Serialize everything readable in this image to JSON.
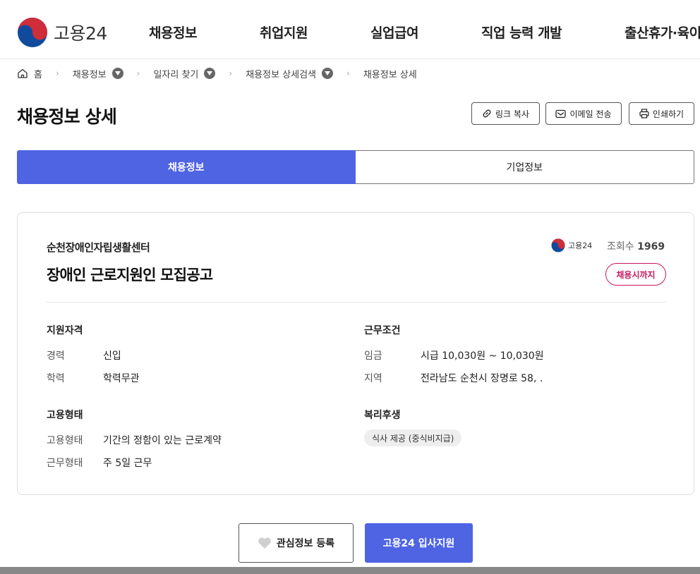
{
  "header": {
    "logo_text": "고용24",
    "nav": [
      "채용정보",
      "취업지원",
      "실업급여",
      "직업 능력 개발",
      "출산휴가·육이"
    ]
  },
  "breadcrumb": {
    "home": "홈",
    "items": [
      "채용정보",
      "일자리 찾기",
      "채용정보 상세검색",
      "채용정보 상세"
    ]
  },
  "page": {
    "title": "채용정보 상세",
    "actions": {
      "copy_link": "링크 복사",
      "email": "이메일 전송",
      "print": "인쇄하기"
    }
  },
  "tabs": [
    "채용정보",
    "기업정보"
  ],
  "posting": {
    "company": "순천장애인자립생활센터",
    "title": "장애인 근로지원인 모집공고",
    "source": "고용24",
    "views_label": "조회수",
    "views": "1969",
    "deadline": "채용시까지"
  },
  "sections": {
    "qualification": {
      "heading": "지원자격",
      "rows": [
        {
          "key": "경력",
          "value": "신입"
        },
        {
          "key": "학력",
          "value": "학력무관"
        }
      ]
    },
    "conditions": {
      "heading": "근무조건",
      "rows": [
        {
          "key": "임금",
          "value": "시급 10,030원 ~ 10,030원"
        },
        {
          "key": "지역",
          "value": "전라남도 순천시 장명로 58, ."
        }
      ]
    },
    "employment": {
      "heading": "고용형태",
      "rows": [
        {
          "key": "고용형태",
          "value": "기간의 정함이 있는 근로계약"
        },
        {
          "key": "근무형태",
          "value": "주 5일 근무"
        }
      ]
    },
    "welfare": {
      "heading": "복리후생",
      "chips": [
        "식사 제공 (중식비지급)"
      ]
    }
  },
  "buttons": {
    "favorite": "관심정보 등록",
    "apply": "고용24 입사지원"
  },
  "colors": {
    "primary": "#4f64e3",
    "deadline": "#c7175f",
    "taegeuk_red": "#cd2e3a",
    "taegeuk_blue": "#0f4a9c"
  }
}
